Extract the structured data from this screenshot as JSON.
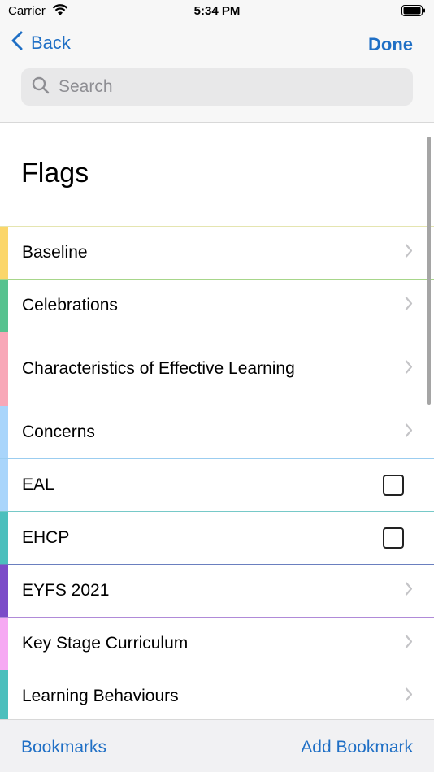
{
  "status": {
    "carrier": "Carrier",
    "time": "5:34 PM"
  },
  "nav": {
    "back_label": "Back",
    "done_label": "Done"
  },
  "search": {
    "placeholder": "Search"
  },
  "page": {
    "title": "Flags"
  },
  "rows": [
    {
      "label": "Baseline",
      "color": "#fbd66a",
      "accessory": "chevron",
      "border": "#a7d68a"
    },
    {
      "label": "Celebrations",
      "color": "#57c28f",
      "accessory": "chevron",
      "border": "#9fc1e6"
    },
    {
      "label": "Characteristics of Effective Learning",
      "color": "#f8a8b8",
      "accessory": "chevron",
      "border": "#e7a9c6"
    },
    {
      "label": "Concerns",
      "color": "#a9d5fb",
      "accessory": "chevron",
      "border": "#9bcdf0"
    },
    {
      "label": "EAL",
      "color": "#a9d5fb",
      "accessory": "checkbox",
      "border": "#76c9c8"
    },
    {
      "label": "EHCP",
      "color": "#4bbfbd",
      "accessory": "checkbox",
      "border": "#6a7fbf"
    },
    {
      "label": "EYFS 2021",
      "color": "#7b4cc8",
      "accessory": "chevron",
      "border": "#b08ad8"
    },
    {
      "label": "Key Stage Curriculum",
      "color": "#f6a9f3",
      "accessory": "chevron",
      "border": "#b1a5e6"
    },
    {
      "label": "Learning Behaviours",
      "color": "#4bbfbd",
      "accessory": "chevron",
      "border": "#5a85c6"
    }
  ],
  "toolbar": {
    "bookmarks_label": "Bookmarks",
    "add_bookmark_label": "Add Bookmark"
  },
  "colors": {
    "accent": "#1f6fc5"
  },
  "icons": {
    "back": "chevron-left-icon",
    "search": "magnifier-icon",
    "row": "chevron-right-icon",
    "check": "checkbox-empty"
  }
}
